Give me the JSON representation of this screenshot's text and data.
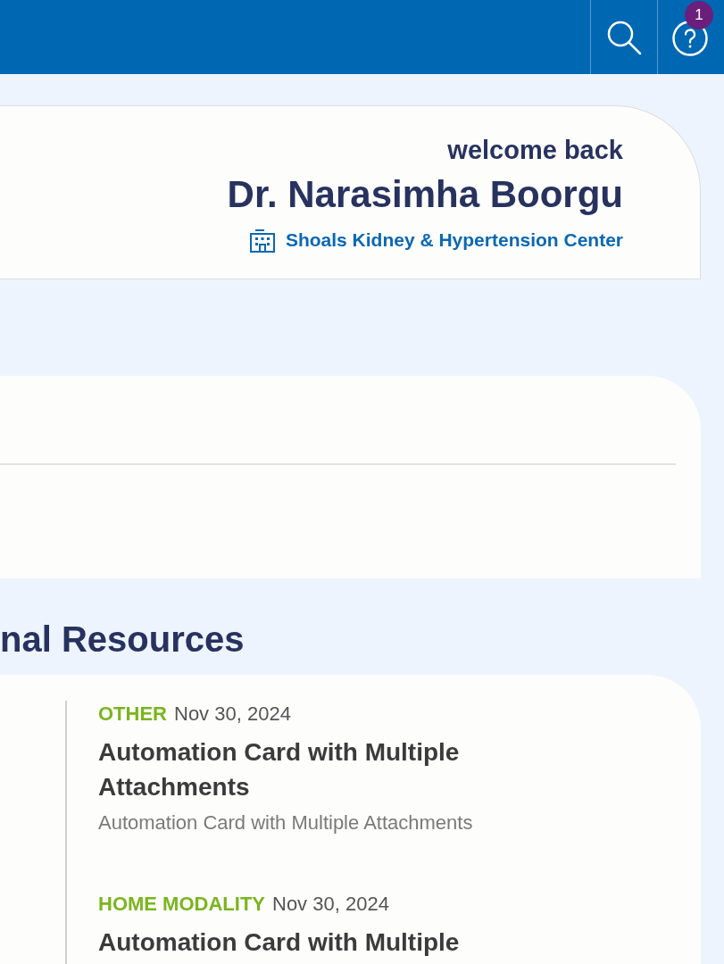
{
  "header": {
    "notification_count": "1"
  },
  "welcome_card": {
    "greeting": "welcome back",
    "name": "Dr. Narasimha Boorgu",
    "organization": "Shoals Kidney & Hypertension Center"
  },
  "section_title": "nal Resources",
  "resources": [
    {
      "category": "OTHER",
      "date": "Nov 30, 2024",
      "title": "Automation Card with Multiple Attachments",
      "description": "Automation Card with Multiple Attachments"
    },
    {
      "category": "HOME MODALITY",
      "date": "Nov 30, 2024",
      "title": "Automation Card with Multiple"
    }
  ]
}
